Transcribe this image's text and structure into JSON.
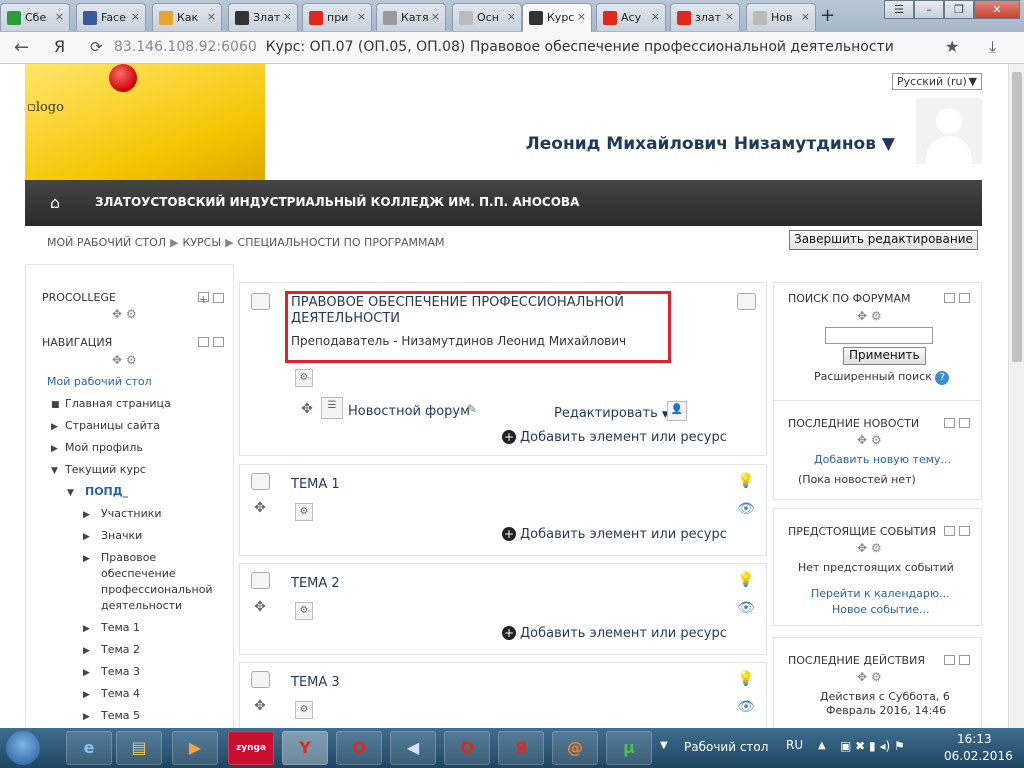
{
  "browser": {
    "tabs": [
      {
        "label": "Сбе",
        "fav": "#2a9d3a",
        "active": false
      },
      {
        "label": "Face",
        "fav": "#3b5998",
        "active": false
      },
      {
        "label": "Как",
        "fav": "#e6a530",
        "active": false
      },
      {
        "label": "Злат",
        "fav": "#333333",
        "active": false
      },
      {
        "label": "при",
        "fav": "#e3271b",
        "active": false
      },
      {
        "label": "Катя",
        "fav": "#999999",
        "active": false
      },
      {
        "label": "Осн",
        "fav": "#bbbbbb",
        "active": false
      },
      {
        "label": "Курс",
        "fav": "#333333",
        "active": true
      },
      {
        "label": "Асу",
        "fav": "#e3271b",
        "active": false
      },
      {
        "label": "злат",
        "fav": "#e3271b",
        "active": false
      },
      {
        "label": "Нов",
        "fav": "#bbbbbb",
        "active": false
      }
    ],
    "url_host": "83.146.108.92:6060",
    "page_title": "Курс: ОП.07 (ОП.05, ОП.08) Правовое обеспечение профессиональной деятельности",
    "yandex_logo": "Я"
  },
  "header": {
    "logo_alt": "logo",
    "language": "Русский (ru)",
    "user_name": "Леонид Михайлович Низамутдинов ▼"
  },
  "navbar": {
    "title": "ЗЛАТОУСТОВСКИЙ ИНДУСТРИАЛЬНЫЙ КОЛЛЕДЖ ИМ. П.П. АНОСОВА"
  },
  "breadcrumb": [
    "МОЙ РАБОЧИЙ СТОЛ",
    "КУРСЫ",
    "СПЕЦИАЛЬНОСТИ ПО ПРОГРАММАМ"
  ],
  "end_edit_label": "Завершить редактирование",
  "left": {
    "block1_title": "PROCOLLEGE",
    "block2_title": "НАВИГАЦИЯ",
    "items": [
      "Мой рабочий стол",
      "Главная страница",
      "Страницы сайта",
      "Мой профиль",
      "Текущий курс",
      "ПОПД_",
      "Участники",
      "Значки",
      "Правовое",
      "обеспечение",
      "профессиональной",
      "деятельности",
      "Тема 1",
      "Тема 2",
      "Тема 3",
      "Тема 4",
      "Тема 5"
    ]
  },
  "main": {
    "course_title_1": "ПРАВОВОЕ ОБЕСПЕЧЕНИЕ ПРОФЕССИОНАЛЬНОЙ",
    "course_title_2": "ДЕЯТЕЛЬНОСТИ",
    "teacher": "Преподаватель - Низамутдинов Леонид Михайлович",
    "forum": "Новостной форум",
    "edit_label": "Редактировать",
    "add_resource": "Добавить элемент или ресурс",
    "topics": [
      "ТЕМА 1",
      "ТЕМА 2",
      "ТЕМА 3"
    ]
  },
  "right": {
    "search_title": "ПОИСК ПО ФОРУМАМ",
    "apply": "Применить",
    "advanced": "Расширенный поиск",
    "news_title": "ПОСЛЕДНИЕ НОВОСТИ",
    "add_topic": "Добавить новую тему...",
    "no_news": "(Пока новостей нет)",
    "events_title": "ПРЕДСТОЯЩИЕ СОБЫТИЯ",
    "no_events": "Нет предстоящих событий",
    "calendar": "Перейти к календарю...",
    "new_event": "Новое событие...",
    "actions_title": "ПОСЛЕДНИЕ ДЕЙСТВИЯ",
    "actions_since_1": "Действия с Суббота, 6",
    "actions_since_2": "Февраль 2016, 14:46"
  },
  "taskbar": {
    "desktop": "Рабочий стол",
    "lang": "RU",
    "time": "16:13",
    "date": "06.02.2016"
  }
}
